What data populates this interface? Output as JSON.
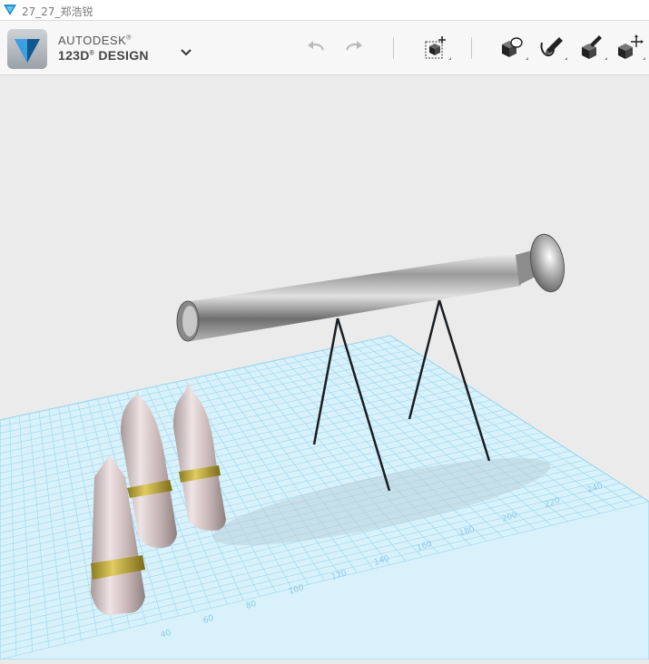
{
  "window": {
    "title": "27_27_郑浩锐"
  },
  "app": {
    "brand_line1": "AUTODESK",
    "brand_line2": "123D",
    "brand_line2b": "DESIGN"
  },
  "toolbar": {
    "buttons": [
      {
        "name": "undo-button",
        "icon": "undo-arrow"
      },
      {
        "name": "redo-button",
        "icon": "redo-arrow"
      },
      {
        "name": "primitives-button",
        "icon": "cube-plus"
      },
      {
        "name": "construct-button",
        "icon": "cube-shape"
      },
      {
        "name": "sketch-button",
        "icon": "cube-pencil"
      },
      {
        "name": "modify-button",
        "icon": "cube-brush"
      },
      {
        "name": "transform-button",
        "icon": "cube-move"
      }
    ]
  },
  "grid": {
    "tick_labels": [
      "40",
      "60",
      "80",
      "100",
      "120",
      "140",
      "160",
      "180",
      "200",
      "220",
      "240"
    ]
  },
  "colors": {
    "grid_fill": "#d5f0fa",
    "grid_line": "#7fcde8",
    "metal": "#c9c9c9",
    "band": "#b8a43a",
    "bottle": "#d9c5c5"
  }
}
